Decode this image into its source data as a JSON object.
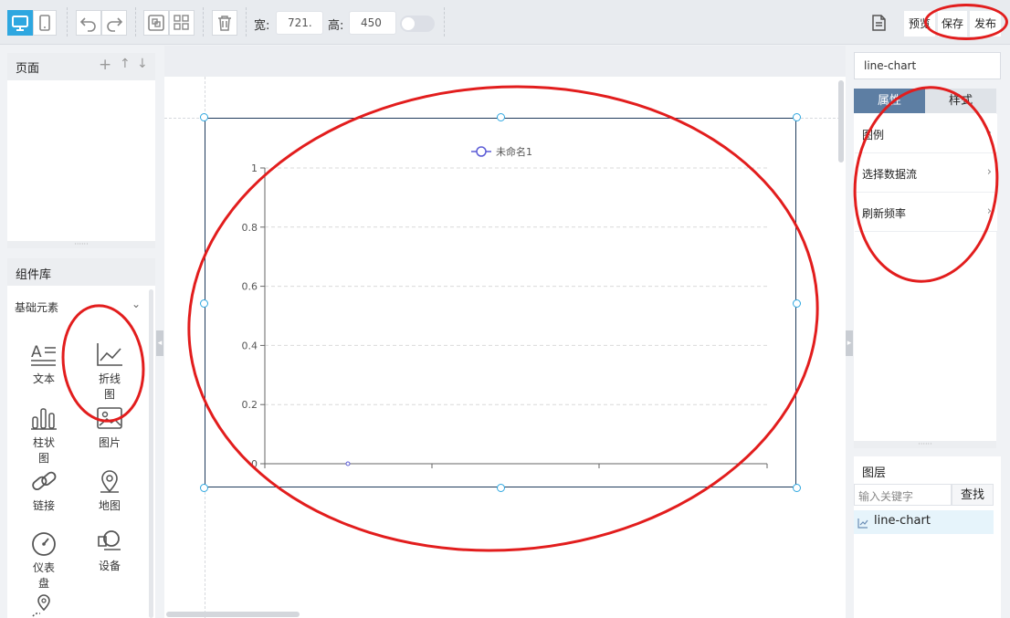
{
  "toolbar": {
    "width_label": "宽:",
    "width_value": "721.",
    "height_label": "高:",
    "height_value": "450",
    "preview_label": "预览",
    "save_label": "保存",
    "publish_label": "发布"
  },
  "pages_panel": {
    "title": "页面"
  },
  "component_library": {
    "title": "组件库",
    "category": "基础元素",
    "items": [
      {
        "label": "文本",
        "icon": "text-icon"
      },
      {
        "label": "折线图",
        "icon": "line-chart-icon"
      },
      {
        "label": "柱状图",
        "icon": "bar-chart-icon"
      },
      {
        "label": "图片",
        "icon": "image-icon"
      },
      {
        "label": "链接",
        "icon": "link-icon"
      },
      {
        "label": "地图",
        "icon": "map-pin-icon"
      },
      {
        "label": "仪表盘",
        "icon": "gauge-icon"
      },
      {
        "label": "设备",
        "icon": "device-icon"
      }
    ]
  },
  "canvas_chart": {
    "legend": "未命名1",
    "colors": {
      "series": "#5b5bd6",
      "frame": "#1f3b5c",
      "handle": "#2ea7e0"
    }
  },
  "chart_data": {
    "type": "line",
    "series": [
      {
        "name": "未命名1",
        "values": [
          0
        ]
      }
    ],
    "x": [
      0
    ],
    "yticks": [
      "1",
      "0.8",
      "0.6",
      "0.4",
      "0.2",
      "0"
    ],
    "ylim": [
      0,
      1
    ],
    "grid": true,
    "legend_position": "top"
  },
  "right_panel": {
    "component_name": "line-chart",
    "tabs": [
      "属性",
      "样式"
    ],
    "properties": [
      "图例",
      "选择数据流",
      "刷新频率"
    ]
  },
  "layers": {
    "title": "图层",
    "search_placeholder": "输入关键字",
    "search_button": "查找",
    "items": [
      {
        "label": "line-chart",
        "icon": "line-chart-icon"
      }
    ]
  },
  "colors": {
    "accent": "#2ea7e0",
    "annotation": "#e21d1d",
    "tab_active": "#5d7ea3"
  }
}
